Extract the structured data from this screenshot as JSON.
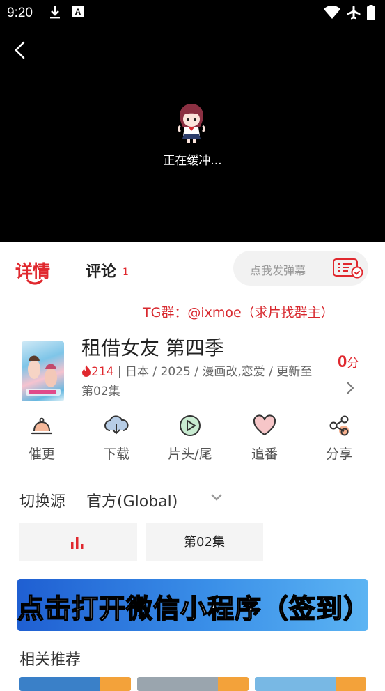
{
  "status_bar": {
    "time": "9:20",
    "app_badge": "A"
  },
  "player": {
    "buffering_text": "正在缓冲..."
  },
  "tabs": {
    "detail": "详情",
    "comments": "评论",
    "comments_count": "1"
  },
  "danmaku": {
    "placeholder": "点我发弹幕"
  },
  "notice": {
    "text": "TG群：@ixmoe（求片找群主）"
  },
  "anime": {
    "title": "租借女友 第四季",
    "heat": "214",
    "meta_rest": " | 日本 / 2025 / 漫画改,恋爱 / 更新至第02集",
    "score": "0",
    "score_unit": "分"
  },
  "actions": [
    {
      "label": "催更",
      "icon": "bell-icon"
    },
    {
      "label": "下载",
      "icon": "cloud-download-icon"
    },
    {
      "label": "片头/尾",
      "icon": "play-circle-icon"
    },
    {
      "label": "追番",
      "icon": "heart-icon"
    },
    {
      "label": "分享",
      "icon": "share-icon"
    }
  ],
  "source": {
    "label": "切换源",
    "value": "官方(Global)"
  },
  "episodes": [
    {
      "label": "",
      "playing": true
    },
    {
      "label": "第02集"
    }
  ],
  "banner": {
    "text": "点击打开微信小程序（签到）"
  },
  "recommend": {
    "title": "相关推荐"
  },
  "colors": {
    "accent": "#e0282e",
    "banner": "#2f7fe0"
  }
}
